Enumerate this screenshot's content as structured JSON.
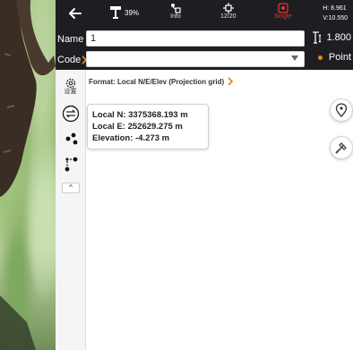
{
  "status_bar": {
    "battery_percent": "39%",
    "info_label": "Info",
    "satellites": "12/20",
    "solution": "Single",
    "h_precision": "H: 8.961",
    "v_precision": "V:10.550"
  },
  "name_row": {
    "label": "Name",
    "value": "1",
    "antenna_height": "1.800"
  },
  "code_row": {
    "label": "Code",
    "value": "",
    "point_type": "Point"
  },
  "toolbar": {
    "settings_label": "设置",
    "collapse_label": "^"
  },
  "format": {
    "label": "Format: Local N/E/Elev (Projection grid)"
  },
  "coordinates": {
    "north": "Local N: 3375368.193 m",
    "east": "Local E: 252629.275 m",
    "elevation": "Elevation: -4.273 m"
  },
  "colors": {
    "bar": "#1e1e22",
    "accent": "#f0831e",
    "solution_red": "#e8322d"
  }
}
